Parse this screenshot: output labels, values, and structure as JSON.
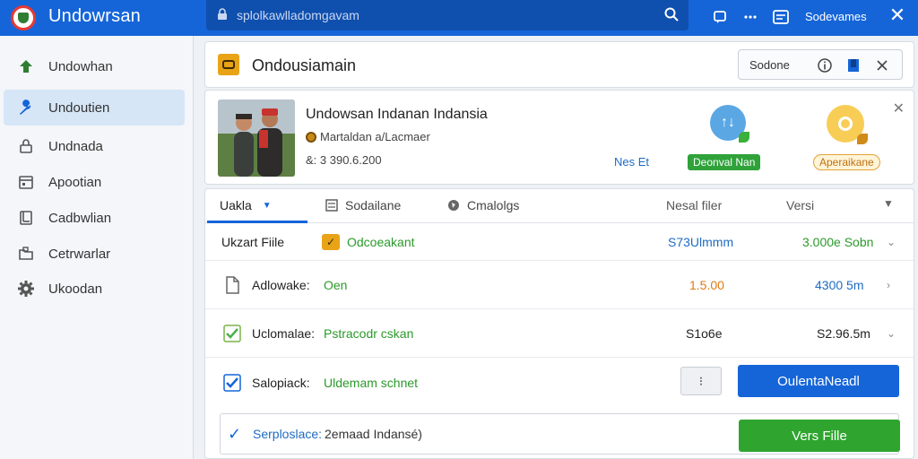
{
  "app": {
    "title": "Undowrsan",
    "url": "splolkawlladomgavam",
    "toolbar_label": "Sodevames",
    "colors": {
      "brand": "#1565d8",
      "green": "#2fa52f",
      "orange": "#e07a12"
    }
  },
  "sidebar": {
    "items": [
      {
        "label": "Undowhan",
        "icon": "tree-icon",
        "active": false
      },
      {
        "label": "Undoutien",
        "icon": "wrench-icon",
        "active": true
      },
      {
        "label": "Undnada",
        "icon": "lock-icon",
        "active": false
      },
      {
        "label": "Apootian",
        "icon": "calendar-icon",
        "active": false
      },
      {
        "label": "Cadbwlian",
        "icon": "document-icon",
        "active": false
      },
      {
        "label": "Cetrwarlar",
        "icon": "folder-share-icon",
        "active": false
      },
      {
        "label": "Ukoodan",
        "icon": "gear-icon",
        "active": false
      }
    ]
  },
  "header": {
    "title": "Ondousiamain",
    "select_label": "Sodone"
  },
  "info": {
    "title": "Undowsan Indanan Indansia",
    "subtitle": "Martaldan a/Lacmaer",
    "size": "&: 3 390.6.200",
    "link_label": "Nes Et",
    "green_pill": "Deonval Nan",
    "orange_pill": "Aperaikane"
  },
  "tabs": {
    "items": [
      "Uakla",
      "Sodailane",
      "Cmalolgs"
    ],
    "col_file": "Nesal filer",
    "col_version": "Versi"
  },
  "rows": [
    {
      "label": "Ukzart Fiile",
      "value": "Odcoeakant",
      "size": "S73Ulmmm",
      "version": "3.000e Sobn"
    },
    {
      "label": "Adlowake:",
      "value": "Oen",
      "size": "1.5.00",
      "version": "4300 5m"
    },
    {
      "label": "Uclomalae:",
      "value": "Pstracodr cskan",
      "size": "S1o6e",
      "version": "S2.96.5m"
    },
    {
      "label": "Salopiack:",
      "value": "Uldemam schnet",
      "small_button": "⁝",
      "primary_button": "OulentaNeadl"
    },
    {
      "label": "Serploslace: ",
      "value": "2emaad Indansé)",
      "primary_button": "Vers Fille"
    }
  ]
}
